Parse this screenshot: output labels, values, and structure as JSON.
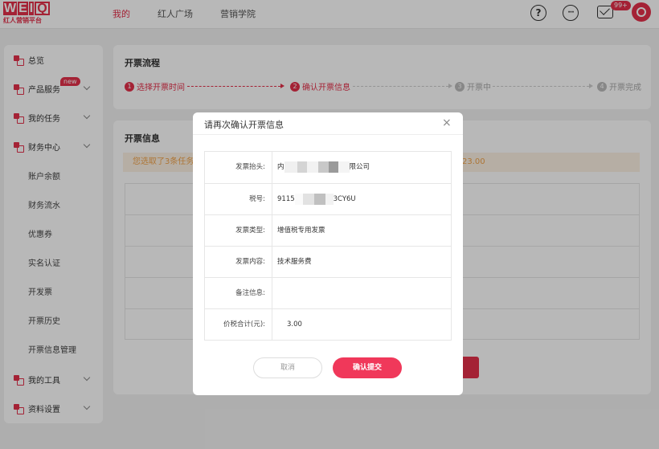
{
  "logo": {
    "letters": [
      "W",
      "E",
      "I",
      "Q"
    ],
    "tagline": "红人营销平台"
  },
  "nav": {
    "items": [
      "我的",
      "红人广场",
      "营销学院"
    ],
    "active_index": 0
  },
  "header": {
    "help_icon_text": "?",
    "more_icon_text": "···",
    "mail_badge": "99+"
  },
  "sidebar": {
    "items": [
      {
        "label": "总览",
        "icon": true,
        "chevron": false
      },
      {
        "label": "产品服务",
        "icon": true,
        "chevron": true,
        "badge": "new"
      },
      {
        "label": "我的任务",
        "icon": true,
        "chevron": true
      },
      {
        "label": "财务中心",
        "icon": true,
        "chevron": true
      },
      {
        "label": "账户余额",
        "icon": false,
        "chevron": false
      },
      {
        "label": "财务流水",
        "icon": false,
        "chevron": false
      },
      {
        "label": "优惠券",
        "icon": false,
        "chevron": false
      },
      {
        "label": "实名认证",
        "icon": false,
        "chevron": false
      },
      {
        "label": "开发票",
        "icon": false,
        "chevron": false
      },
      {
        "label": "开票历史",
        "icon": false,
        "chevron": false
      },
      {
        "label": "开票信息管理",
        "icon": false,
        "chevron": false
      },
      {
        "label": "我的工具",
        "icon": true,
        "chevron": true
      },
      {
        "label": "资料设置",
        "icon": true,
        "chevron": true
      }
    ]
  },
  "process": {
    "title": "开票流程",
    "steps": [
      {
        "num": "1",
        "label": "选择开票时间",
        "state": "on"
      },
      {
        "num": "2",
        "label": "确认开票信息",
        "state": "on"
      },
      {
        "num": "3",
        "label": "开票中",
        "state": "off"
      },
      {
        "num": "4",
        "label": "开票完成",
        "state": "off"
      }
    ]
  },
  "info": {
    "title": "开票信息",
    "notice_text": "您选取了3条任务",
    "notice_amount": "23.00"
  },
  "modal": {
    "title": "请再次确认开票信息",
    "close": "×",
    "rows": [
      {
        "label": "发票抬头:",
        "value_prefix": "内",
        "value_suffix": "限公司"
      },
      {
        "label": "税号:",
        "value_prefix": "9115",
        "value_suffix": "3CY6U"
      },
      {
        "label": "发票类型:",
        "value_prefix": "增值税专用发票",
        "value_suffix": ""
      },
      {
        "label": "发票内容:",
        "value_prefix": "技术服务费",
        "value_suffix": ""
      },
      {
        "label": "备注信息:",
        "value_prefix": "",
        "value_suffix": ""
      },
      {
        "label": "价税合计(元):",
        "value_prefix": "3.00",
        "value_suffix": ""
      }
    ],
    "cancel_label": "取消",
    "confirm_label": "确认提交"
  },
  "colors": {
    "accent": "#e3304a",
    "warning_bg": "#fdf1e3",
    "warning_text": "#f0a34a"
  }
}
